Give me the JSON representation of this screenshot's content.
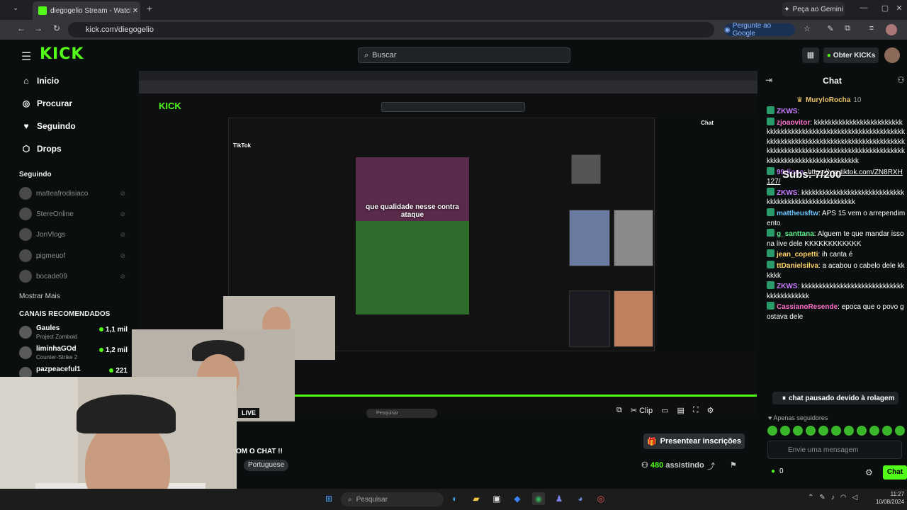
{
  "browser": {
    "tab_title": "diegogelio Stream - Watch Live",
    "tab_close": "✕",
    "new_tab": "+",
    "url": "kick.com/diegogelio",
    "gemini_button": "Peça ao Gemini",
    "ask_google": "Pergunte ao Google"
  },
  "header": {
    "logo": "KICK",
    "search_placeholder": "Buscar",
    "obter_button": "Obter KICKs"
  },
  "sidebar": {
    "nav": [
      {
        "label": "Inicio",
        "icon": "home-icon"
      },
      {
        "label": "Procurar",
        "icon": "compass-icon"
      },
      {
        "label": "Seguindo",
        "icon": "heart-icon"
      },
      {
        "label": "Drops",
        "icon": "drop-icon"
      }
    ],
    "following_header": "Seguindo",
    "following": [
      "matteafrodisiaco",
      "StereOnline",
      "JonVlogs",
      "pigmeuof",
      "bocade09"
    ],
    "show_more": "Mostrar Mais",
    "recommended_header": "CANAIS RECOMENDADOS",
    "recommended": [
      {
        "name": "Gaules",
        "game": "Project Zomboid",
        "viewers": "1,1 mil"
      },
      {
        "name": "liminhaGOd",
        "game": "Counter-Strike 2",
        "viewers": "1,2 mil"
      },
      {
        "name": "pazpeaceful1",
        "game": "",
        "viewers": "221"
      }
    ]
  },
  "stream": {
    "live_tag": "LIVE",
    "title": "OM O CHAT !!",
    "language": "Portuguese",
    "present_button": "Presentear inscrições",
    "viewers_count": "480",
    "viewers_label": "assistindo",
    "clip_label": "Clip",
    "tiktok_caption": "que qualidade nesse contra ataque",
    "tiktok_logo": "TikTok",
    "inner_search": "Pesquisar"
  },
  "chat": {
    "header": "Chat",
    "pinned_user": "MuryloRocha",
    "pinned_level": "10",
    "subs_overlay": "Subs: 7/200",
    "messages": [
      {
        "user": "ZKWS",
        "color": "#c77dff",
        "text": ""
      },
      {
        "user": "zjoaovitor",
        "color": "#ff6ec7",
        "text": "kkkkkkkkkkkkkkkkkkkkkkkkkkkkkkkkkkkkkkkkkkkkkkkkkkkkkkkkkkkkkkkkkkkkkkkkkkkkkkkkkkkkkkkkkkkkkkkkkkkkkkkkkkkkkkkkkkkkkkkkkkkkkkkkkkkkkkkkkkkkkkkkkkkkkkkkkkkkkkkkkkkkkkkk"
      },
      {
        "user": "99diogo",
        "color": "#c77dff",
        "text": "https://vm.tiktok.com/ZN8RXH127/",
        "link": true
      },
      {
        "user": "ZKWS",
        "color": "#c77dff",
        "text": "kkkkkkkkkkkkkkkkkkkkkkkkkkkkkkkkkkkkkkkkkkkkkkkkkkkkkk"
      },
      {
        "user": "mattheusftw",
        "color": "#6ec7ff",
        "text": "APS 15 vem o arrependimento"
      },
      {
        "user": "g_santtana",
        "color": "#5ef08a",
        "text": "Alguem te que mandar isso na live dele KKKKKKKKKKKK"
      },
      {
        "user": "jean_copetti",
        "color": "#ffd166",
        "text": "ih canta é"
      },
      {
        "user": "ttDanielsilva",
        "color": "#ffd166",
        "text": "a acabou o cabelo dele kkkkkk"
      },
      {
        "user": "ZKWS",
        "color": "#c77dff",
        "text": "kkkkkkkkkkkkkkkkkkkkkkkkkkkkkkkkkkkkkkkkk"
      },
      {
        "user": "CassianoResende",
        "color": "#ff6ec7",
        "text": "epoca que o povo gostava dele"
      }
    ],
    "paused_banner": "chat pausado devido à rolagem",
    "followers_only": "Apenas seguidores",
    "input_placeholder": "Envie uma mensagem",
    "kicks_count": "0",
    "send_button": "Chat"
  },
  "taskbar": {
    "search_placeholder": "Pesquisar",
    "time": "11:27",
    "date": "10/08/2024"
  },
  "colors": {
    "accent": "#53fc18",
    "background": "#0b0e0f"
  }
}
